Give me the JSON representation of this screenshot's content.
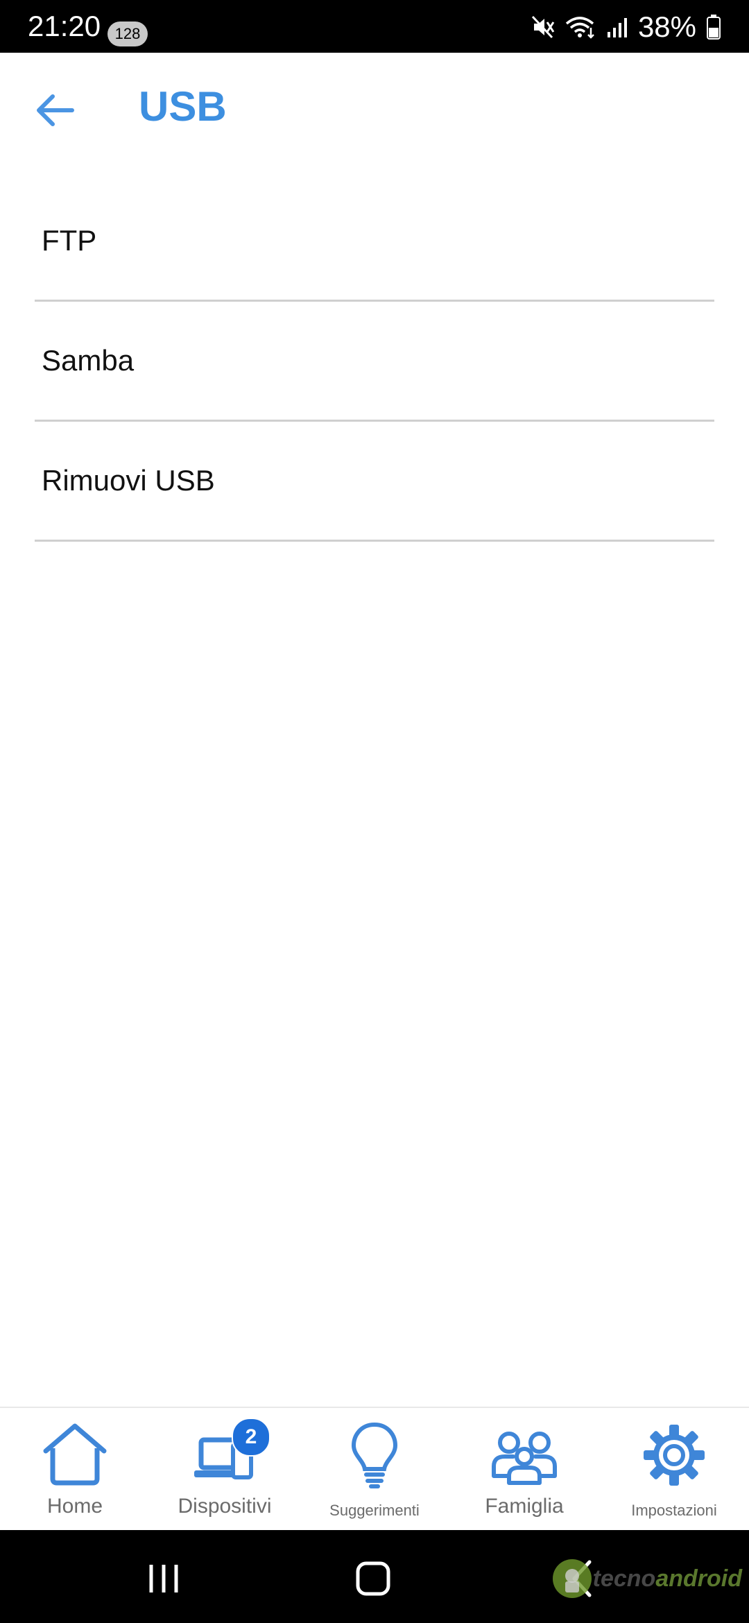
{
  "status_bar": {
    "time": "21:20",
    "notification_count": "128",
    "battery_text": "38%"
  },
  "header": {
    "title": "USB",
    "accent_color": "#3d8fe0"
  },
  "menu": {
    "items": [
      {
        "label": "FTP"
      },
      {
        "label": "Samba"
      },
      {
        "label": "Rimuovi USB"
      }
    ]
  },
  "bottom_nav": {
    "icon_color": "#3f86d8",
    "items": [
      {
        "label": "Home",
        "icon": "home-icon"
      },
      {
        "label": "Dispositivi",
        "icon": "devices-icon",
        "badge": "2"
      },
      {
        "label": "Suggerimenti",
        "icon": "lightbulb-icon"
      },
      {
        "label": "Famiglia",
        "icon": "family-icon"
      },
      {
        "label": "Impostazioni",
        "icon": "gear-icon"
      }
    ]
  },
  "watermark": {
    "prefix": "tecno",
    "suffix": "android"
  }
}
